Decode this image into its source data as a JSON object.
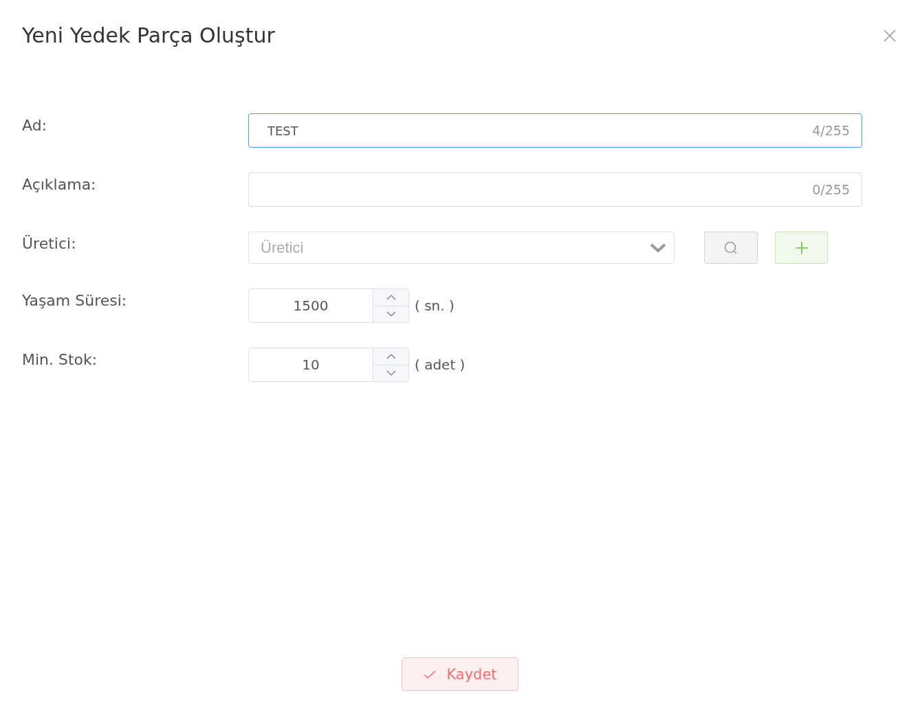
{
  "dialog": {
    "title": "Yeni Yedek Parça Oluştur"
  },
  "fields": [
    {
      "kind": "text",
      "label": "Ad:",
      "value": "TEST",
      "counter": "4/255",
      "focused": true
    },
    {
      "kind": "text",
      "label": "Açıklama:",
      "counter": "0/255",
      "focused": false
    },
    {
      "kind": "select",
      "label": "Üretici:",
      "placeholder": "Üretici",
      "focused": false
    },
    {
      "kind": "number",
      "label": "Yaşam Süresi:",
      "value": "1500",
      "unit": "( sn. )",
      "focused": false
    },
    {
      "kind": "number",
      "label": "Min. Stok:",
      "value": "10",
      "unit": "( adet )",
      "focused": false
    }
  ],
  "save_button": {
    "label": "Kaydet"
  }
}
